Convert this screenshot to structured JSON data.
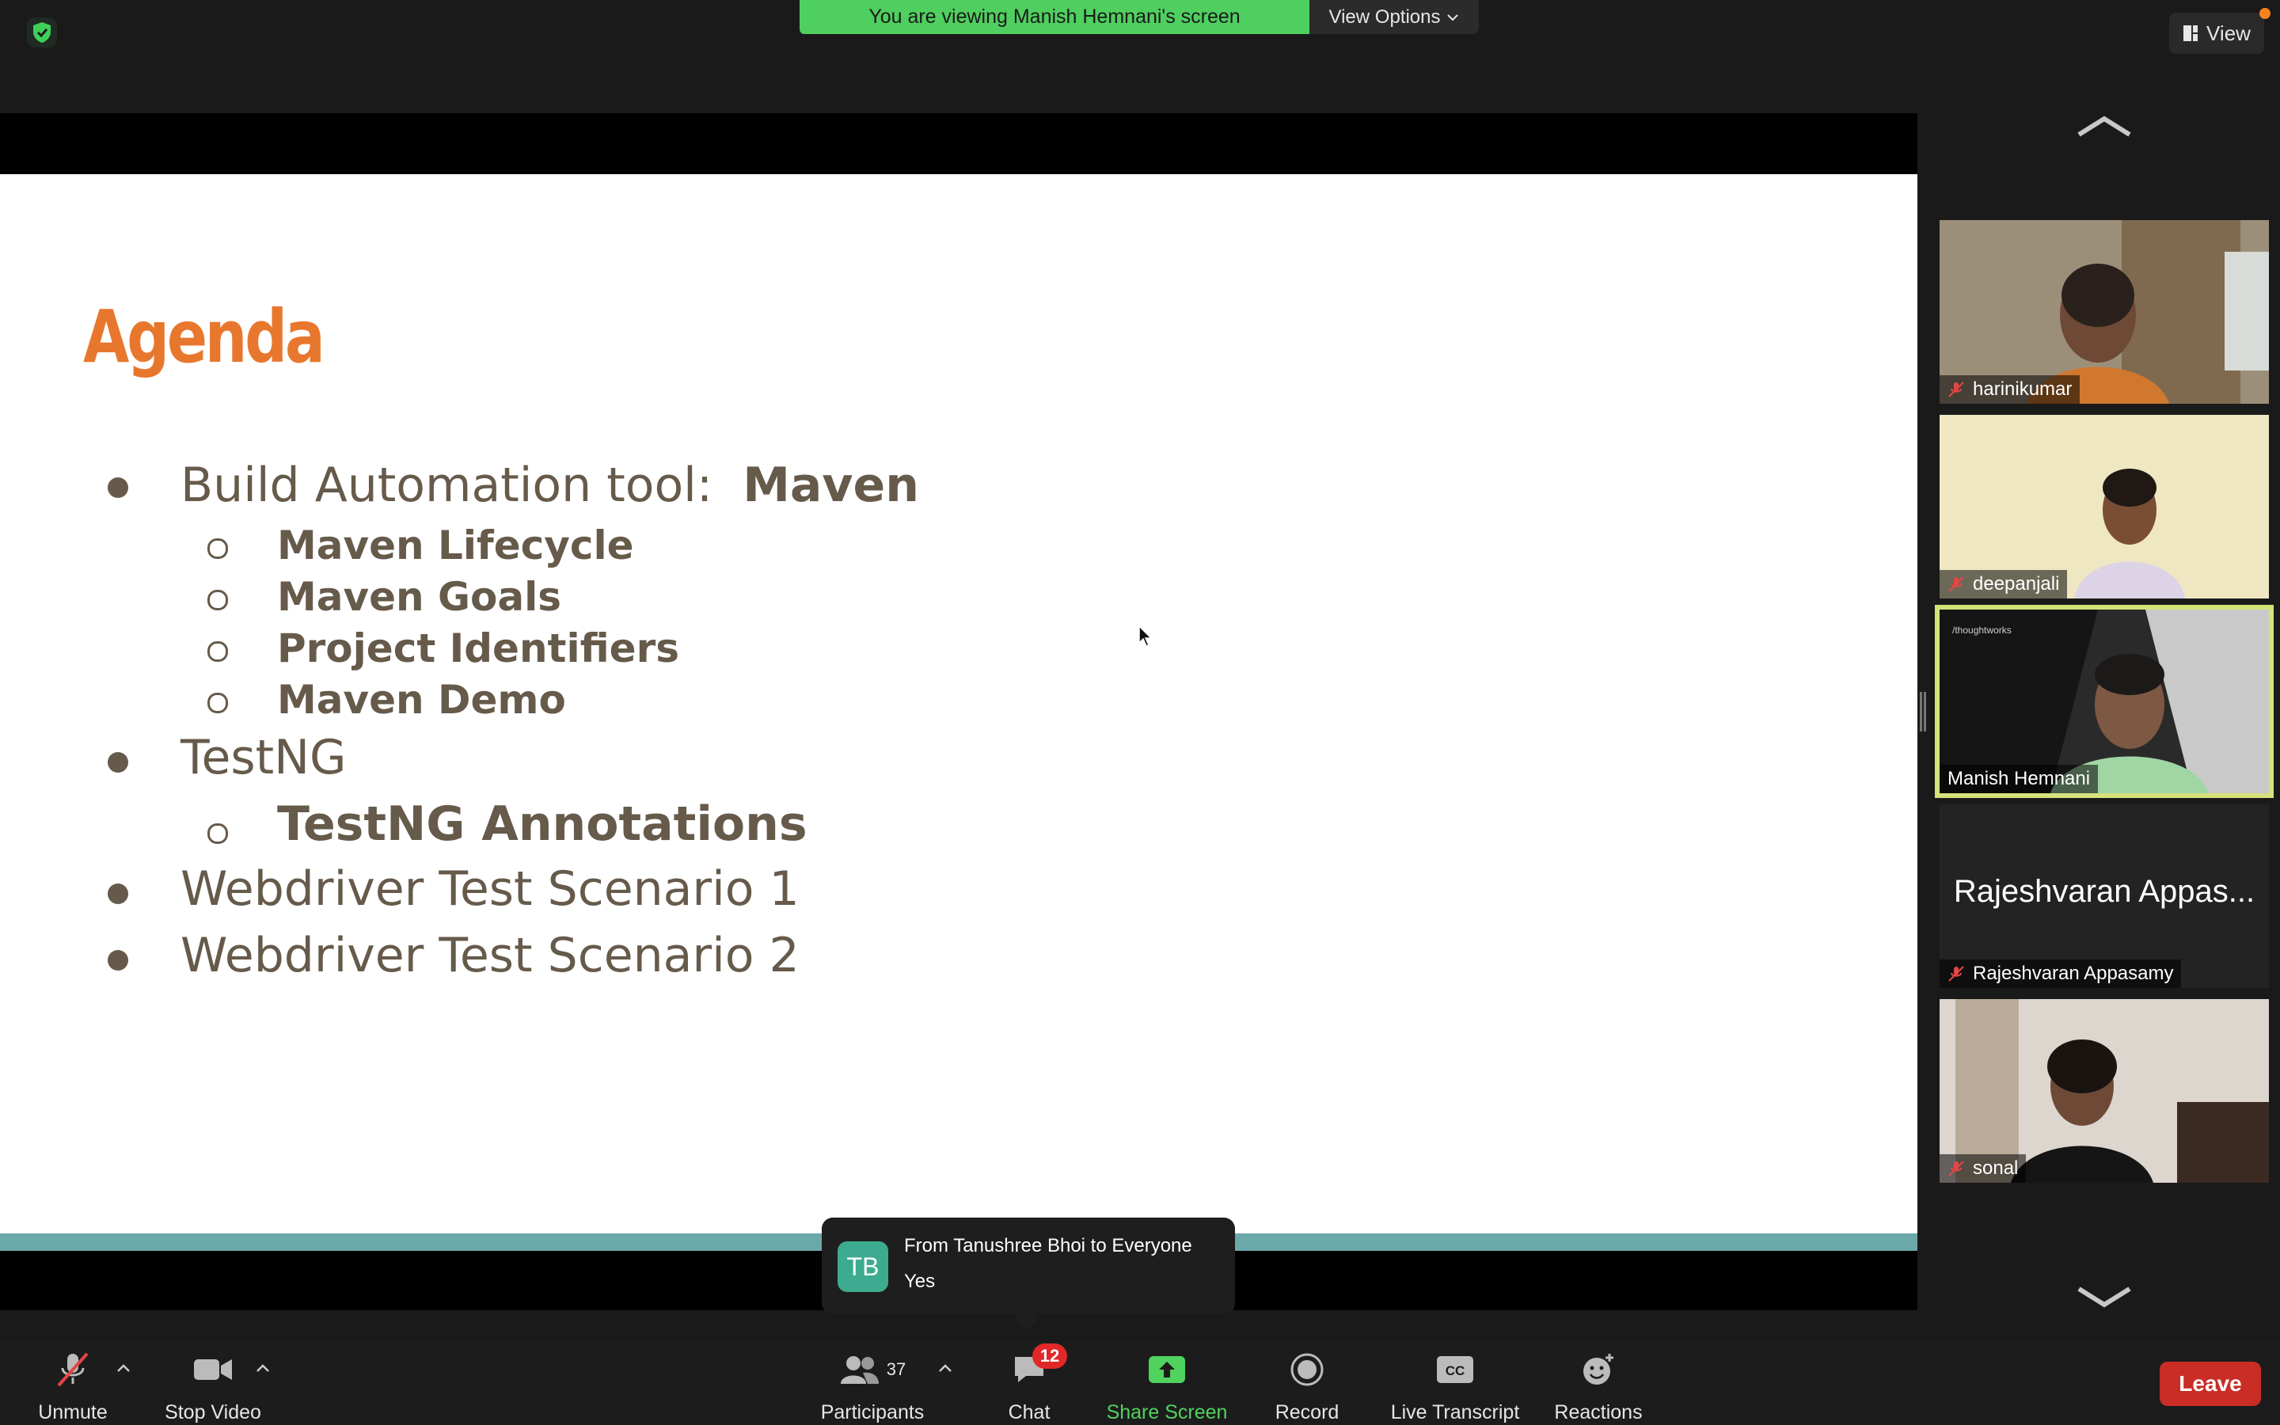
{
  "top": {
    "viewing_banner": "You are viewing Manish Hemnani's screen",
    "view_options": "View Options",
    "view": "View"
  },
  "slide": {
    "title": "Agenda",
    "items": [
      {
        "text": "Build Automation tool:",
        "emphasis": "Maven"
      },
      {
        "text": "Maven Lifecycle"
      },
      {
        "text": "Maven Goals"
      },
      {
        "text": "Project Identifiers"
      },
      {
        "text": "Maven Demo"
      },
      {
        "text": "TestNG"
      },
      {
        "text": "TestNG Annotations"
      },
      {
        "text": "Webdriver Test Scenario 1"
      },
      {
        "text": "Webdriver Test Scenario 2"
      }
    ],
    "colors": {
      "title": "#e8772e",
      "text": "#665a4b",
      "stripe": "#6ba8aa"
    }
  },
  "gallery": {
    "participants": [
      {
        "name": "harinikumar",
        "muted": true
      },
      {
        "name": "deepanjali",
        "muted": true
      },
      {
        "name": "Manish Hemnani",
        "muted": false,
        "active_speaker": true
      },
      {
        "name": "Rajeshvaran Appasamy",
        "display": "Rajeshvaran Appas...",
        "muted": true,
        "video_off": true
      },
      {
        "name": "sonal",
        "muted": true
      }
    ]
  },
  "chat_toast": {
    "initials": "TB",
    "from": "From Tanushree Bhoi to Everyone",
    "message": "Yes"
  },
  "toolbar": {
    "unmute": "Unmute",
    "stop_video": "Stop Video",
    "participants": "Participants",
    "participant_count": "37",
    "chat": "Chat",
    "chat_badge": "12",
    "share_screen": "Share Screen",
    "record": "Record",
    "live_transcript": "Live Transcript",
    "reactions": "Reactions",
    "leave": "Leave"
  }
}
